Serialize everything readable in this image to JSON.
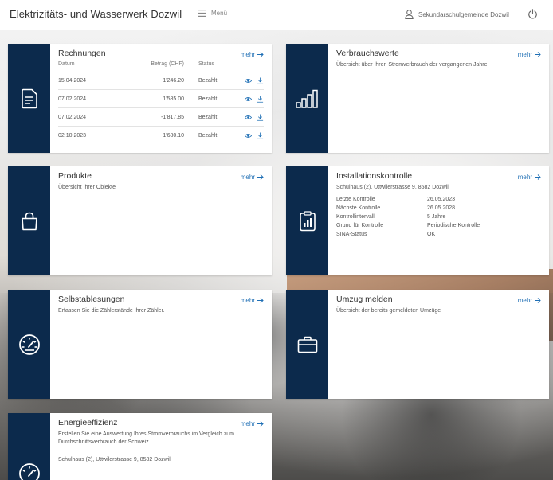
{
  "header": {
    "app_title": "Elektrizitäts- und Wasserwerk Dozwil",
    "menu_label": "Menü",
    "user_label": "Sekundarschulgemeinde Dozwil"
  },
  "cards": {
    "rechnungen": {
      "title": "Rechnungen",
      "mehr": "mehr",
      "columns": {
        "date": "Datum",
        "amount": "Betrag (CHF)",
        "status": "Status"
      },
      "rows": [
        {
          "date": "15.04.2024",
          "amount": "1'246.20",
          "status": "Bezahlt"
        },
        {
          "date": "07.02.2024",
          "amount": "1'585.00",
          "status": "Bezahlt"
        },
        {
          "date": "07.02.2024",
          "amount": "-1'817.85",
          "status": "Bezahlt"
        },
        {
          "date": "02.10.2023",
          "amount": "1'680.10",
          "status": "Bezahlt"
        }
      ]
    },
    "verbrauch": {
      "title": "Verbrauchswerte",
      "mehr": "mehr",
      "desc": "Übersicht über Ihren Stromverbrauch der vergangenen Jahre"
    },
    "produkte": {
      "title": "Produkte",
      "mehr": "mehr",
      "desc": "Übersicht Ihrer Objekte"
    },
    "installation": {
      "title": "Installationskontrolle",
      "mehr": "mehr",
      "address": "Schulhaus (2), Uttwilerstrasse 9, 8582 Dozwil",
      "rows": [
        {
          "k": "Letzte Kontrolle",
          "v": "26.05.2023"
        },
        {
          "k": "Nächste Kontrolle",
          "v": "26.05.2028"
        },
        {
          "k": "Kontrollintervall",
          "v": "5 Jahre"
        },
        {
          "k": "Grund für Kontrolle",
          "v": "Periodische Kontrolle"
        },
        {
          "k": "SINA-Status",
          "v": "OK"
        }
      ]
    },
    "selbstablesungen": {
      "title": "Selbstablesungen",
      "mehr": "mehr",
      "desc": "Erfassen Sie die Zählerstände Ihrer Zähler."
    },
    "umzug": {
      "title": "Umzug melden",
      "mehr": "mehr",
      "desc": "Übersicht der bereits gemeldeten Umzüge"
    },
    "energie": {
      "title": "Energieeffizienz",
      "mehr": "mehr",
      "desc": "Erstellen Sie eine Auswertung Ihres Stromverbrauchs im Vergleich zum Durchschnittsverbrauch der Schweiz",
      "address": "Schulhaus (2), Uttwilerstrasse 9, 8582 Dozwil"
    }
  },
  "colors": {
    "sidebar": "#0c2a4c",
    "link": "#1f6fb5"
  }
}
